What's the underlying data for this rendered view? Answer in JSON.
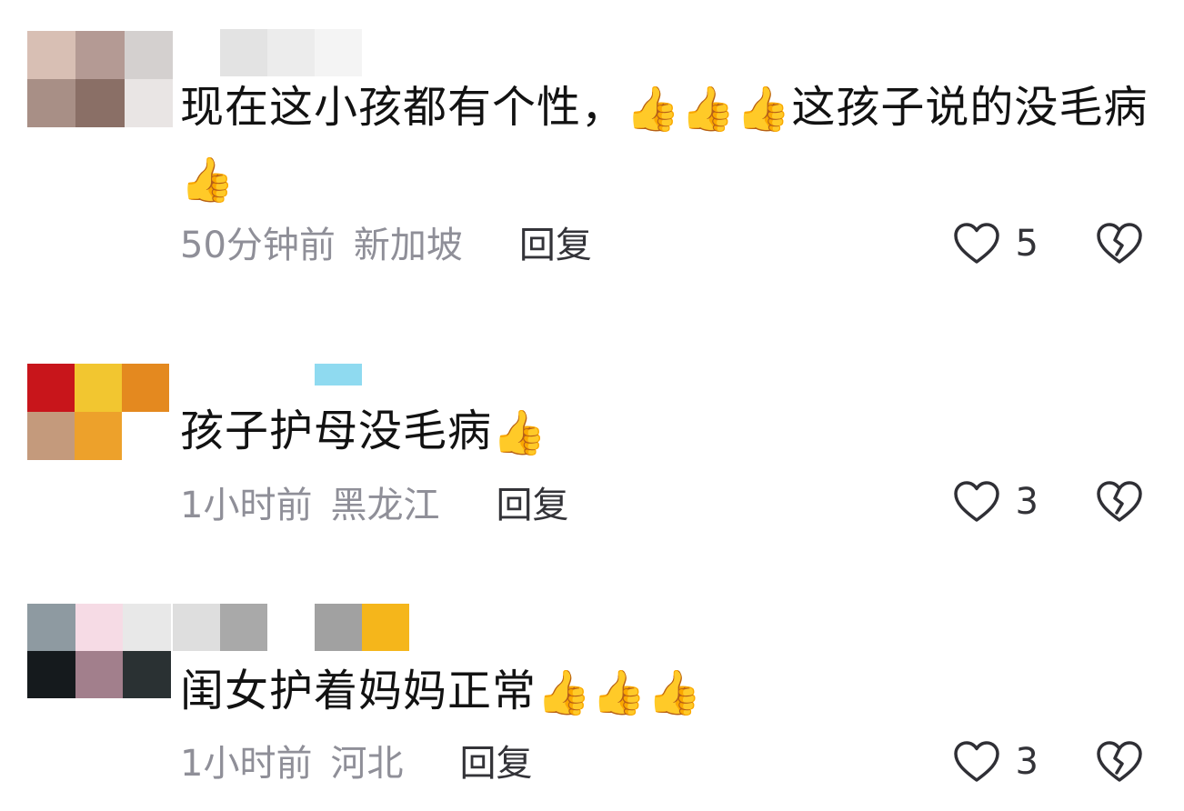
{
  "comments": [
    {
      "text": "现在这小孩都有个性，",
      "text_after": "这孩子说的没毛病",
      "emoji_mid": "👍👍👍",
      "emoji_end": "👍",
      "time": "50分钟前",
      "location": "新加坡",
      "reply": "回复",
      "likes": "5",
      "avatar_colors": [
        "#d8bfb4",
        "#b49a94",
        "#d4d0cf",
        "#a88f86",
        "#8a6f66",
        "#e9e5e4"
      ],
      "username_colors": [
        "#e3e3e3",
        "#ececec",
        "#f4f4f4"
      ]
    },
    {
      "text": "孩子护母没毛病",
      "emoji_end": "👍",
      "time": "1小时前",
      "location": "黑龙江",
      "reply": "回复",
      "likes": "3",
      "avatar_colors": [
        "#c8151b",
        "#f2c630",
        "#e4891f",
        "#c49a7c",
        "#eda12b",
        "#ffffff"
      ],
      "username_colors": [
        "#8fdaf0"
      ]
    },
    {
      "text": "闺女护着妈妈正常",
      "emoji_end": "👍👍👍",
      "time": "1小时前",
      "location": "河北",
      "reply": "回复",
      "likes": "3",
      "avatar_colors": [
        "#8e9aa1",
        "#f6dbe5",
        "#e8e8e8",
        "#151a1d",
        "#a27f8c",
        "#2a3133"
      ],
      "username_colors": [
        "#dedede",
        "#a9a9a9",
        "#ffffff",
        "#a1a1a1",
        "#f5b61b"
      ]
    }
  ]
}
